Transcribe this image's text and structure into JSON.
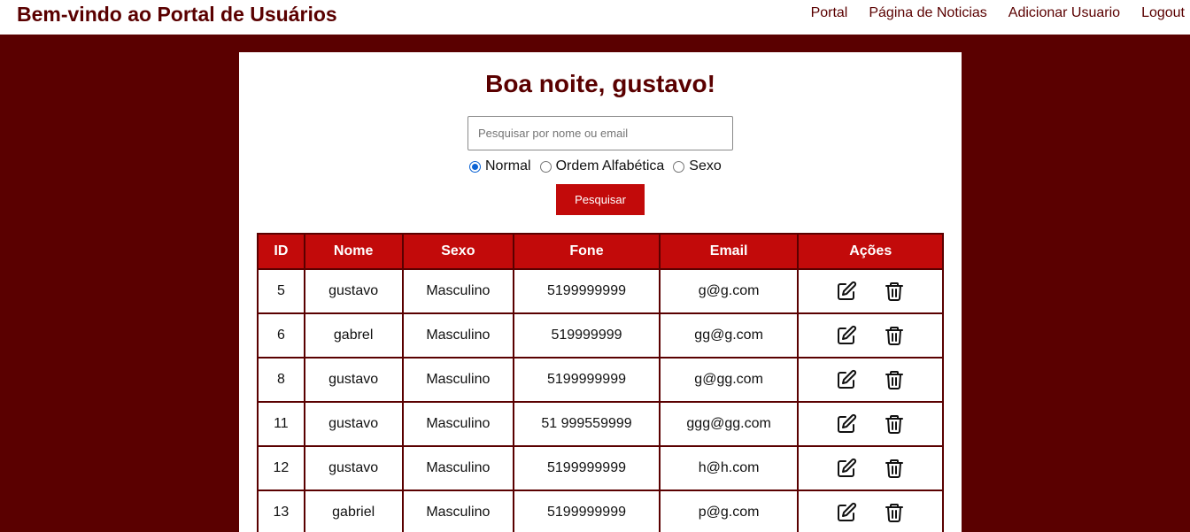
{
  "header": {
    "title": "Bem-vindo ao Portal de Usuários",
    "nav": [
      "Portal",
      "Página de Noticias",
      "Adicionar Usuario",
      "Logout"
    ]
  },
  "main": {
    "greeting": "Boa noite, gustavo!",
    "search_placeholder": "Pesquisar por nome ou email",
    "search_value": "",
    "sort_options": [
      {
        "label": "Normal",
        "checked": true
      },
      {
        "label": "Ordem Alfabética",
        "checked": false
      },
      {
        "label": "Sexo",
        "checked": false
      }
    ],
    "search_button": "Pesquisar"
  },
  "table": {
    "columns": [
      "ID",
      "Nome",
      "Sexo",
      "Fone",
      "Email",
      "Ações"
    ],
    "rows": [
      [
        "5",
        "gustavo",
        "Masculino",
        "5199999999",
        "g@g.com"
      ],
      [
        "6",
        "gabrel",
        "Masculino",
        "519999999",
        "gg@g.com"
      ],
      [
        "8",
        "gustavo",
        "Masculino",
        "5199999999",
        "g@gg.com"
      ],
      [
        "11",
        "gustavo",
        "Masculino",
        "51 999559999",
        "ggg@gg.com"
      ],
      [
        "12",
        "gustavo",
        "Masculino",
        "5199999999",
        "h@h.com"
      ],
      [
        "13",
        "gabriel",
        "Masculino",
        "5199999999",
        "p@g.com"
      ]
    ],
    "row_actions": [
      "edit-icon",
      "trash-icon"
    ]
  },
  "colors": {
    "background": "#5a0000",
    "accent": "#c20a0a",
    "radio": "#0b63d4"
  }
}
